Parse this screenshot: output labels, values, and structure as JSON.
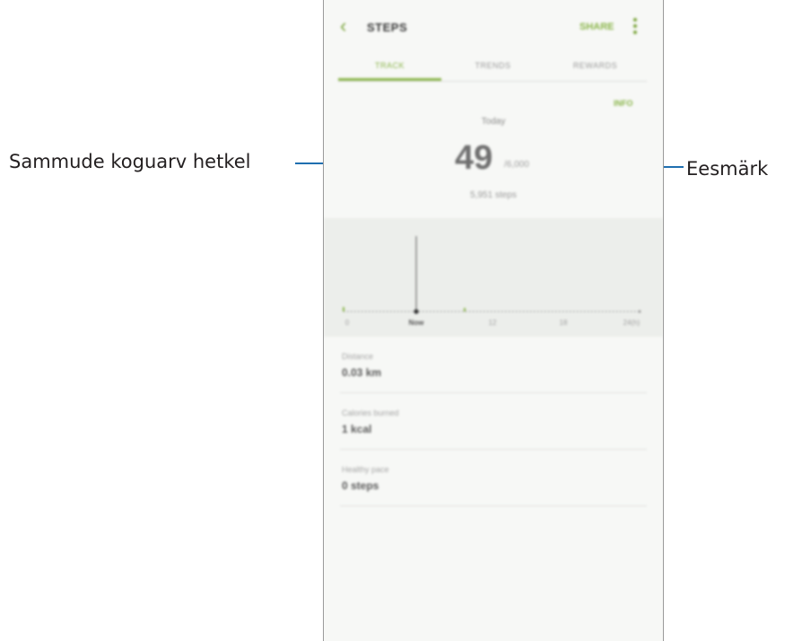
{
  "callouts": {
    "left_label": "Sammude koguarv hetkel",
    "right_label": "Eesmärk"
  },
  "app_bar": {
    "back_icon": "chevron-left-icon",
    "back_glyph": "‹",
    "title": "STEPS",
    "share_label": "SHARE",
    "more_icon": "more-vert-icon"
  },
  "tabs": [
    {
      "label": "TRACK",
      "active": true
    },
    {
      "label": "TRENDS",
      "active": false
    },
    {
      "label": "REWARDS",
      "active": false
    }
  ],
  "summary": {
    "info_label": "INFO",
    "today_label": "Today",
    "steps": "49",
    "goal": "/6,000",
    "remaining": "5,951 steps"
  },
  "chart_data": {
    "type": "bar",
    "x_tick_labels": [
      "0",
      "Now",
      "12",
      "18",
      "24(h)"
    ],
    "current_marker": "Now"
  },
  "stats": [
    {
      "label": "Distance",
      "value": "0.03 km"
    },
    {
      "label": "Calories burned",
      "value": "1 kcal"
    },
    {
      "label": "Healthy pace",
      "value": "0 steps"
    }
  ],
  "colors": {
    "accent": "#8ab54a",
    "callout_line": "#1f6fb0",
    "chart_background": "#eceeeb"
  }
}
